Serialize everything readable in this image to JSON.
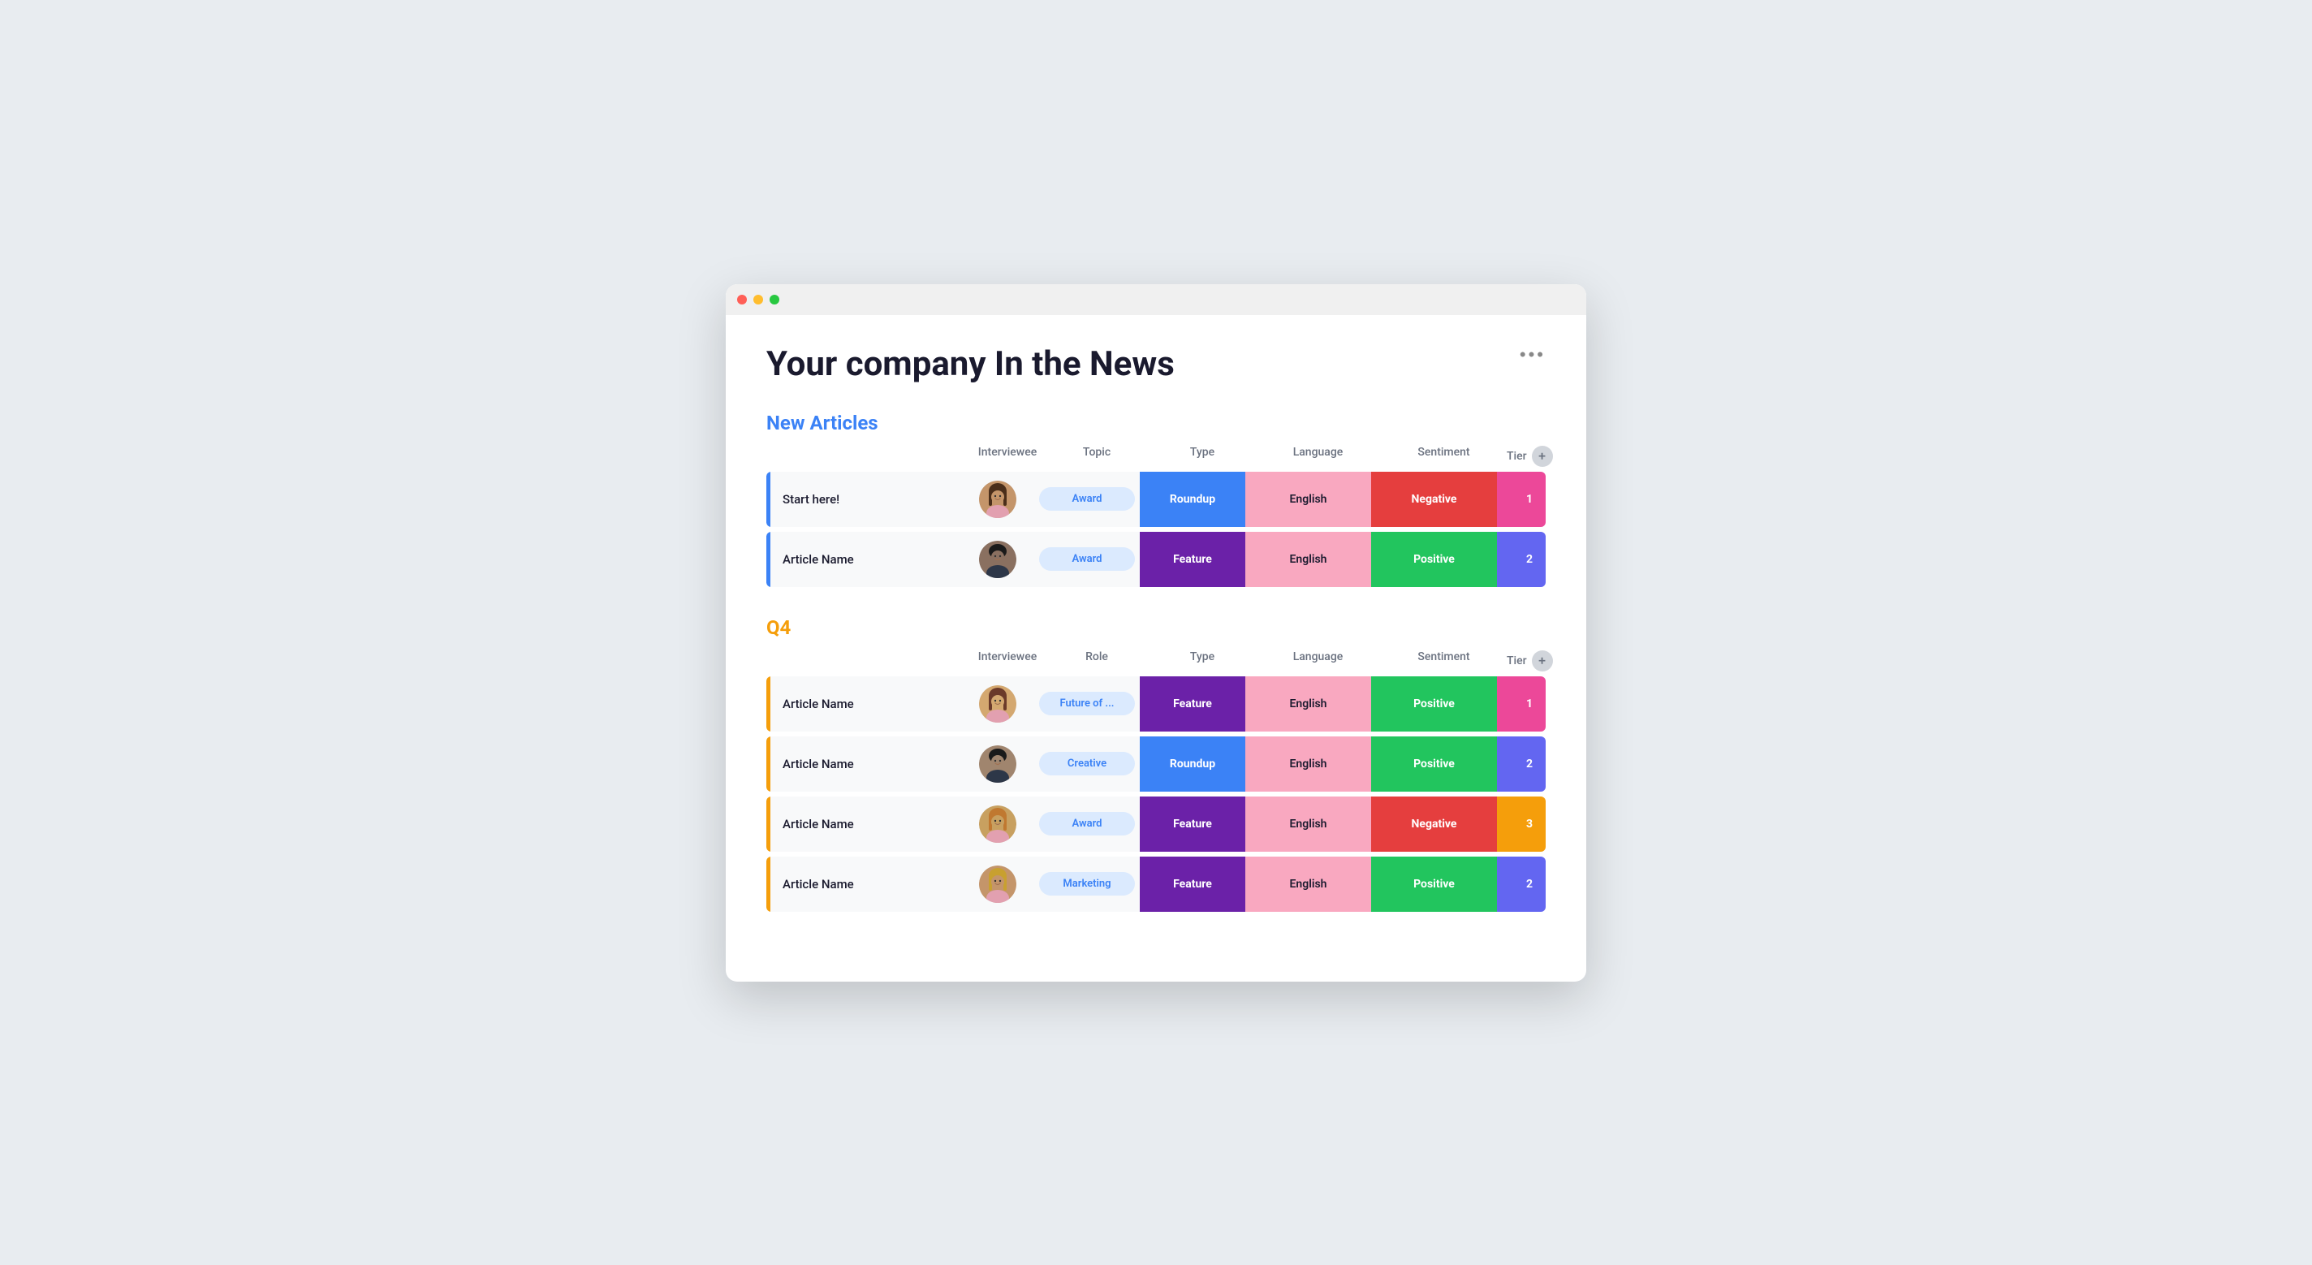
{
  "page": {
    "title": "Your company In the News",
    "more_label": "•••"
  },
  "sections": [
    {
      "id": "new-articles",
      "title": "New Articles",
      "color": "blue",
      "columns": [
        "",
        "Interviewee",
        "Topic",
        "Type",
        "Language",
        "Sentiment",
        "Tier"
      ],
      "rows": [
        {
          "name": "Start here!",
          "avatar": "f1",
          "topic": "Award",
          "type": "Roundup",
          "type_class": "type-roundup",
          "language": "English",
          "sentiment": "Negative",
          "sentiment_class": "sentiment-negative",
          "tier": "1",
          "tier_class": "tier-1",
          "accent": "blue"
        },
        {
          "name": "Article Name",
          "avatar": "m1",
          "topic": "Award",
          "type": "Feature",
          "type_class": "type-feature",
          "language": "English",
          "sentiment": "Positive",
          "sentiment_class": "sentiment-positive",
          "tier": "2",
          "tier_class": "tier-2",
          "accent": "blue"
        }
      ]
    },
    {
      "id": "q4",
      "title": "Q4",
      "color": "orange",
      "columns": [
        "",
        "Interviewee",
        "Role",
        "Type",
        "Language",
        "Sentiment",
        "Tier"
      ],
      "rows": [
        {
          "name": "Article Name",
          "avatar": "f2",
          "topic": "Future of ...",
          "type": "Feature",
          "type_class": "type-feature",
          "language": "English",
          "sentiment": "Positive",
          "sentiment_class": "sentiment-positive",
          "tier": "1",
          "tier_class": "tier-1",
          "accent": "orange"
        },
        {
          "name": "Article Name",
          "avatar": "m2",
          "topic": "Creative",
          "type": "Roundup",
          "type_class": "type-roundup",
          "language": "English",
          "sentiment": "Positive",
          "sentiment_class": "sentiment-positive",
          "tier": "2",
          "tier_class": "tier-2",
          "accent": "orange"
        },
        {
          "name": "Article Name",
          "avatar": "f3",
          "topic": "Award",
          "type": "Feature",
          "type_class": "type-feature",
          "language": "English",
          "sentiment": "Negative",
          "sentiment_class": "sentiment-negative",
          "tier": "3",
          "tier_class": "tier-3",
          "accent": "orange"
        },
        {
          "name": "Article Name",
          "avatar": "f4",
          "topic": "Marketing",
          "type": "Feature",
          "type_class": "type-feature",
          "language": "English",
          "sentiment": "Positive",
          "sentiment_class": "sentiment-positive",
          "tier": "2",
          "tier_class": "tier-2",
          "accent": "orange"
        }
      ]
    }
  ]
}
